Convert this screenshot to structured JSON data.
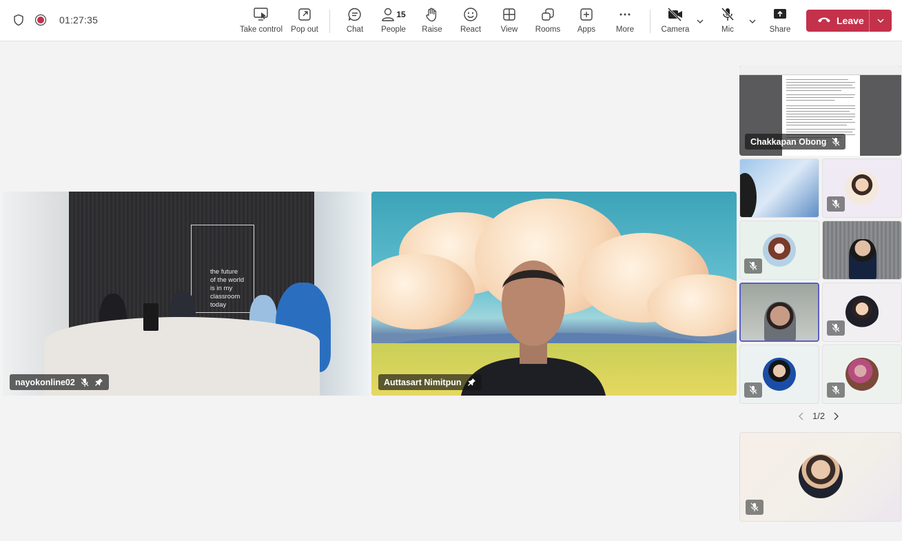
{
  "header": {
    "timer": "01:27:35",
    "buttons": {
      "take_control": "Take control",
      "pop_out": "Pop out",
      "chat": "Chat",
      "people": "People",
      "people_count": "15",
      "raise": "Raise",
      "react": "React",
      "view": "View",
      "rooms": "Rooms",
      "apps": "Apps",
      "more": "More",
      "camera": "Camera",
      "mic": "Mic",
      "share": "Share",
      "leave": "Leave"
    },
    "colors": {
      "leave": "#c4314b",
      "record": "#c4314b",
      "accent": "#5b5fc7"
    }
  },
  "stage": {
    "tiles": [
      {
        "name": "nayokonline02",
        "muted": true,
        "pinned": true
      },
      {
        "name": "Auttasart Nimitpun",
        "muted": false,
        "pinned": true
      }
    ],
    "room_quote": "the future\nof the world\nis in my\nclassroom\ntoday"
  },
  "gallery": {
    "screen_share_presenter": "Chakkapan Obong",
    "pager": "1/2"
  }
}
